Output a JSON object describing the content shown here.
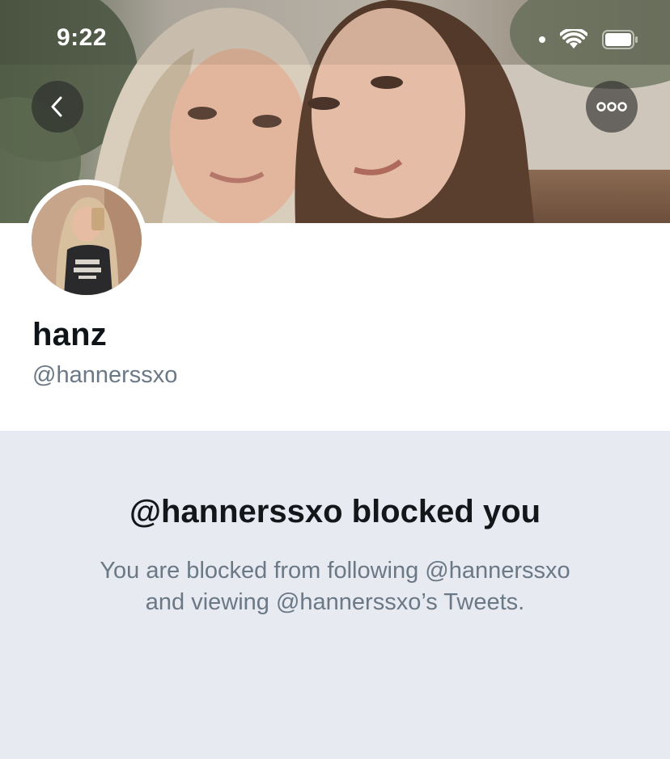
{
  "status_bar": {
    "time": "9:22",
    "icons": [
      "signal-dot-icon",
      "wifi-icon",
      "battery-icon"
    ]
  },
  "header": {
    "back_icon": "chevron-left-icon",
    "more_icon": "more-dots-icon"
  },
  "profile": {
    "name": "hanz",
    "handle": "@hannerssxo"
  },
  "blocked": {
    "title": "@hannerssxo blocked you",
    "line1": "You are blocked from following @hannerssxo",
    "line2": "and viewing @hannerssxo’s Tweets."
  },
  "colors": {
    "panel_background": "#e7eaf0",
    "secondary_text": "#6b7885",
    "primary_text": "#14171a"
  }
}
